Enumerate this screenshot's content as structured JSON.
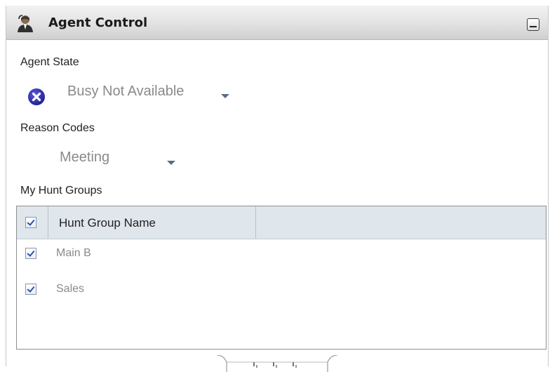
{
  "panel": {
    "title": "Agent Control",
    "title_icon": "agent-icon",
    "collapse_icon": "minimize-icon"
  },
  "agent_state": {
    "label": "Agent State",
    "status_icon": "busy-x-icon",
    "value": "Busy Not Available"
  },
  "reason_codes": {
    "label": "Reason Codes",
    "value": "Meeting"
  },
  "hunt_groups": {
    "label": "My Hunt  Groups",
    "header": {
      "checked": true,
      "column": "Hunt Group Name"
    },
    "rows": [
      {
        "checked": true,
        "name": "Main B"
      },
      {
        "checked": true,
        "name": "Sales"
      }
    ]
  },
  "colors": {
    "titlebar": "#e2e2e2",
    "status_icon": "#2c2ca8",
    "table_header": "#dfe6ec",
    "muted_text": "#8a8a8a"
  }
}
